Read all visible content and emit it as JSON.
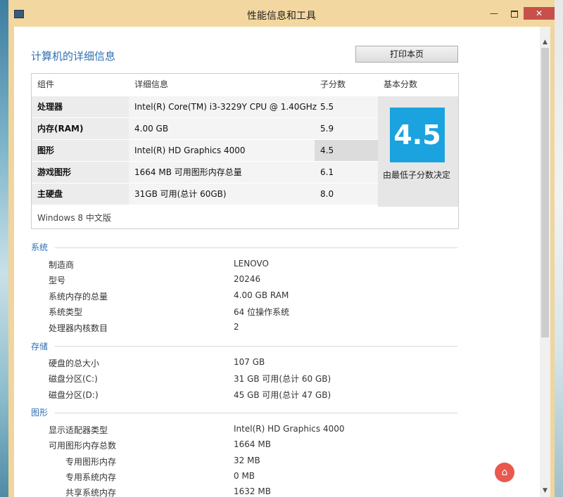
{
  "window": {
    "title": "性能信息和工具",
    "controls": {
      "minimize": "—",
      "close": "✕"
    }
  },
  "heading": "计算机的详细信息",
  "print_button": "打印本页",
  "score_table": {
    "headers": {
      "component": "组件",
      "details": "详细信息",
      "subscore": "子分数",
      "base_score": "基本分数"
    },
    "rows": [
      {
        "component": "处理器",
        "details": "Intel(R) Core(TM) i3-3229Y CPU @ 1.40GHz",
        "subscore": "5.5"
      },
      {
        "component": "内存(RAM)",
        "details": "4.00 GB",
        "subscore": "5.9"
      },
      {
        "component": "图形",
        "details": "Intel(R) HD Graphics 4000",
        "subscore": "4.5"
      },
      {
        "component": "游戏图形",
        "details": "1664 MB 可用图形内存总量",
        "subscore": "6.1"
      },
      {
        "component": "主硬盘",
        "details": "31GB 可用(总计 60GB)",
        "subscore": "8.0"
      }
    ],
    "base_score": "4.5",
    "base_caption": "由最低子分数决定",
    "edition": "Windows 8 中文版"
  },
  "sections": {
    "system": {
      "title": "系统",
      "items": [
        {
          "label": "制造商",
          "value": "LENOVO"
        },
        {
          "label": "型号",
          "value": "20246"
        },
        {
          "label": "系统内存的总量",
          "value": "4.00 GB RAM"
        },
        {
          "label": "系统类型",
          "value": "64 位操作系统"
        },
        {
          "label": "处理器内核数目",
          "value": "2"
        }
      ]
    },
    "storage": {
      "title": "存储",
      "items": [
        {
          "label": "硬盘的总大小",
          "value": "107 GB"
        },
        {
          "label": "磁盘分区(C:)",
          "value": "31 GB 可用(总计 60 GB)"
        },
        {
          "label": "磁盘分区(D:)",
          "value": "45 GB 可用(总计 47 GB)"
        }
      ]
    },
    "graphics": {
      "title": "图形",
      "items": [
        {
          "label": "显示适配器类型",
          "value": "Intel(R) HD Graphics 4000"
        },
        {
          "label": "可用图形内存总数",
          "value": "1664 MB"
        },
        {
          "label": "专用图形内存",
          "value": "32 MB"
        },
        {
          "label": "专用系统内存",
          "value": "0 MB"
        },
        {
          "label": "共享系统内存",
          "value": "1632 MB"
        }
      ]
    }
  },
  "colors": {
    "accent": "#2d6fb5",
    "score_tile": "#1aa3de",
    "titlebar": "#f3d7a1",
    "close": "#c7504a"
  },
  "icons": {
    "scroll_up": "chevron-up-icon",
    "scroll_down": "chevron-down-icon",
    "app": "app-icon"
  }
}
